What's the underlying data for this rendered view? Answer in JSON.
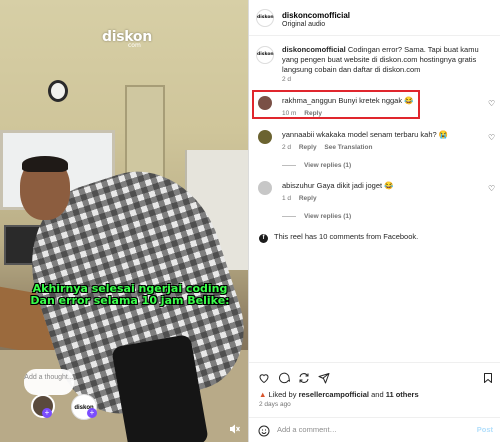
{
  "video": {
    "brand": "diskon",
    "brand_sub": "com",
    "caption": "Akhirnya selesai ngerjai coding Dan error selama 10 jam Belike:",
    "thought_placeholder": "Add a thought...",
    "avatar_brand_label": "diskon"
  },
  "header": {
    "username": "diskoncomofficial",
    "audio": "Original audio",
    "avatar_label": "diskon"
  },
  "caption_comment": {
    "username": "diskoncomofficial",
    "text": "Codingan error? Sama. Tapi buat kamu yang pengen buat website di diskon.com hostingnya gratis langsung cobain dan daftar di diskon.com",
    "age": "2 d"
  },
  "comments": [
    {
      "username": "rakhma_anggun",
      "text": "Bunyi kretek nggak 😂",
      "age": "10 m",
      "reply": "Reply"
    },
    {
      "username": "yannaabii",
      "text": "wkakaka model senam terbaru kah? 😭",
      "age": "2 d",
      "reply": "Reply",
      "see_translation": "See Translation",
      "view_replies": "View replies (1)"
    },
    {
      "username": "abiszuhur",
      "text": "Gaya dikit jadi joget 😂",
      "age": "1 d",
      "reply": "Reply",
      "view_replies": "View replies (1)"
    }
  ],
  "info": {
    "text": "This reel has 10 comments from Facebook."
  },
  "likes": {
    "prefix": "Liked by",
    "user": "resellercampofficial",
    "and": "and",
    "others": "11 others",
    "time": "2 days ago"
  },
  "add_comment": {
    "placeholder": "Add a comment…",
    "post": "Post"
  }
}
